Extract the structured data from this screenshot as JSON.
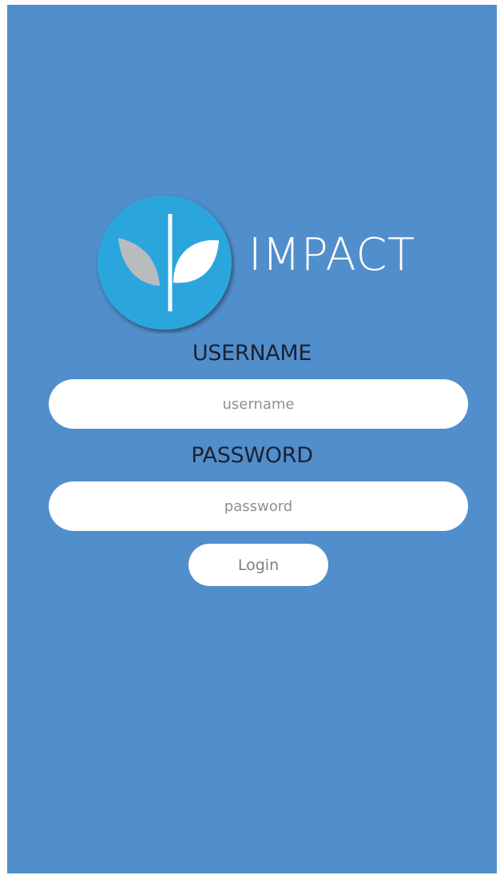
{
  "app": {
    "name": "IMPACT",
    "logo_icon": "sprout-leaf-icon"
  },
  "form": {
    "username_label": "USERNAME",
    "username_placeholder": "username",
    "username_value": "",
    "password_label": "PASSWORD",
    "password_placeholder": "password",
    "password_value": "",
    "login_label": "Login"
  },
  "colors": {
    "background": "#518ecc",
    "logo_circle": "#2aa6dd",
    "leaf_grey": "#b9bcbf",
    "leaf_white": "#ffffff",
    "label_text": "#1c2130"
  }
}
